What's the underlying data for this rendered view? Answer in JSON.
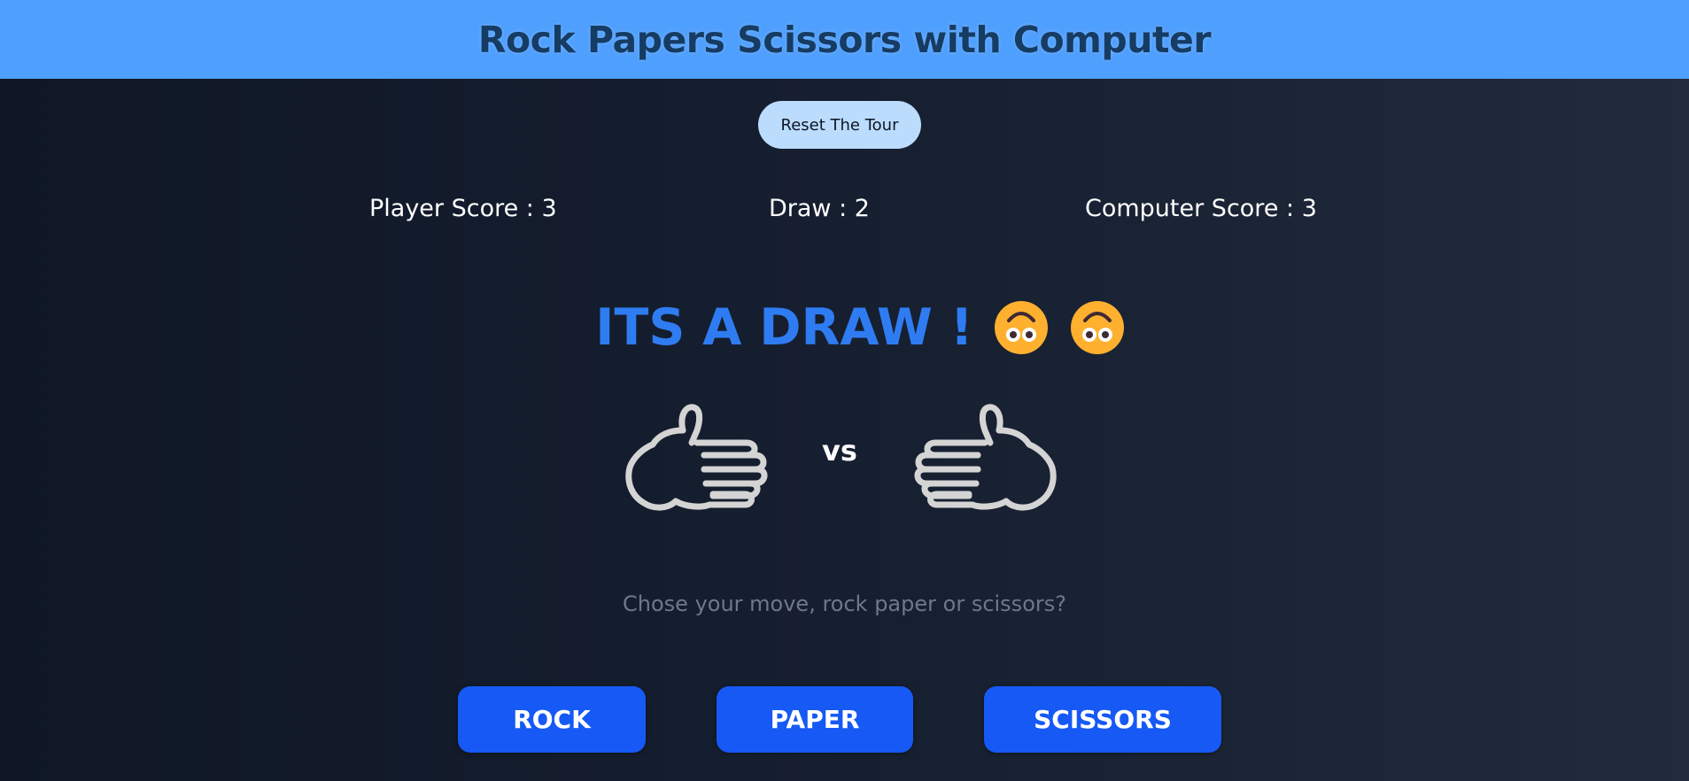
{
  "header": {
    "title": "Rock Papers Scissors with Computer"
  },
  "controls": {
    "reset_label": "Reset The Tour"
  },
  "scores": {
    "player": "Player Score : 3",
    "draw": "Draw : 2",
    "computer": "Computer Score : 3"
  },
  "result": {
    "text": "ITS A DRAW !",
    "emoji": "upside-down-face-emoji"
  },
  "versus": {
    "label": "vs",
    "player_move_icon": "paper-hand-icon",
    "computer_move_icon": "paper-hand-icon"
  },
  "prompt": "Chose your move, rock paper or scissors?",
  "moves": {
    "rock": "ROCK",
    "paper": "PAPER",
    "scissors": "SCISSORS"
  },
  "colors": {
    "header_bg": "#4f9ffe",
    "header_text": "#163c63",
    "result_text": "#2f7cf2",
    "button_bg": "#1659f5",
    "reset_bg": "#bcdcfd"
  }
}
